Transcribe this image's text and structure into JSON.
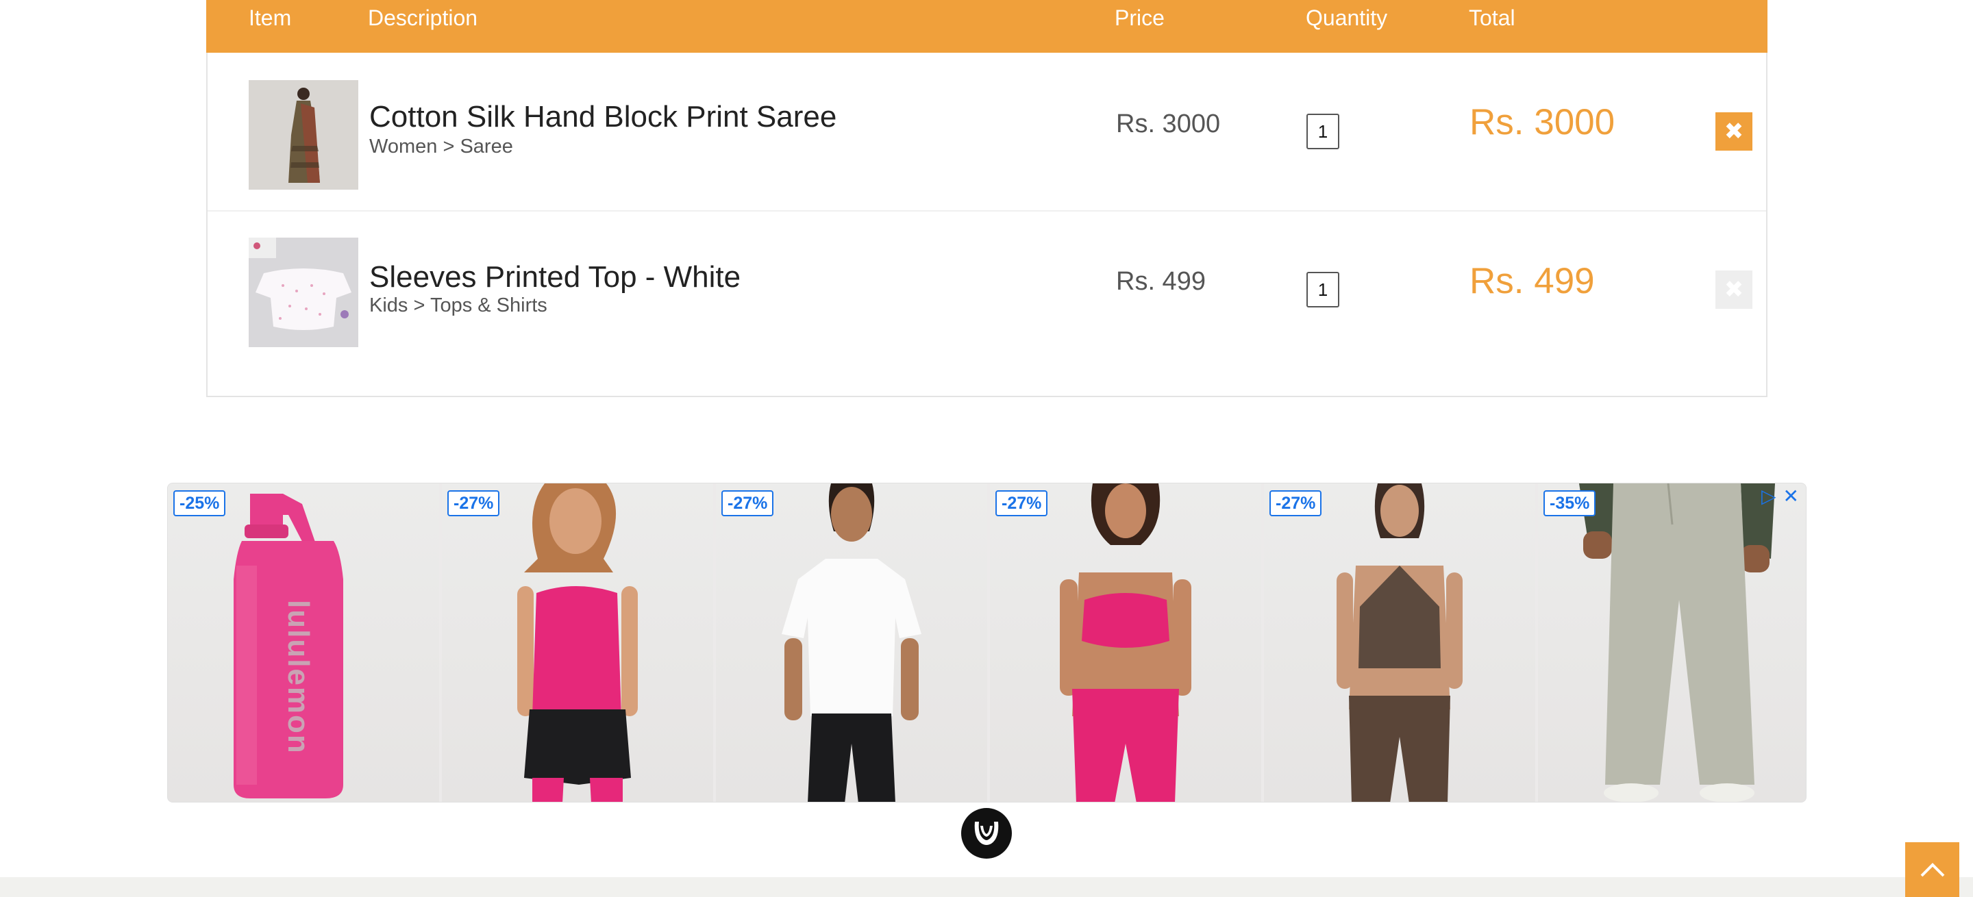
{
  "cart": {
    "headers": {
      "item": "Item",
      "description": "Description",
      "price": "Price",
      "quantity": "Quantity",
      "total": "Total"
    },
    "rows": [
      {
        "title": "Cotton Silk Hand Block Print Saree",
        "category": "Women > Saree",
        "price": "Rs. 3000",
        "quantity": "1",
        "total": "Rs. 3000",
        "remove_icon": "close-icon"
      },
      {
        "title": "Sleeves Printed Top - White",
        "category": "Kids > Tops & Shirts",
        "price": "Rs. 499",
        "quantity": "1",
        "total": "Rs. 499",
        "remove_icon": "close-icon"
      }
    ]
  },
  "ad": {
    "brand_text": "lululemon",
    "items": [
      {
        "discount": "-25%",
        "product": "pink water bottle"
      },
      {
        "discount": "-27%",
        "product": "pink tank top"
      },
      {
        "discount": "-27%",
        "product": "white tee"
      },
      {
        "discount": "-27%",
        "product": "pink sports bra"
      },
      {
        "discount": "-27%",
        "product": "brown halter top"
      },
      {
        "discount": "-35%",
        "product": "sage sweatpants"
      }
    ],
    "adchoices_icon": "adchoices-icon",
    "close_icon": "close-icon"
  },
  "colors": {
    "accent": "#f0a03b",
    "badge_blue": "#1a73e8"
  },
  "scroll_top_icon": "chevron-up-icon"
}
